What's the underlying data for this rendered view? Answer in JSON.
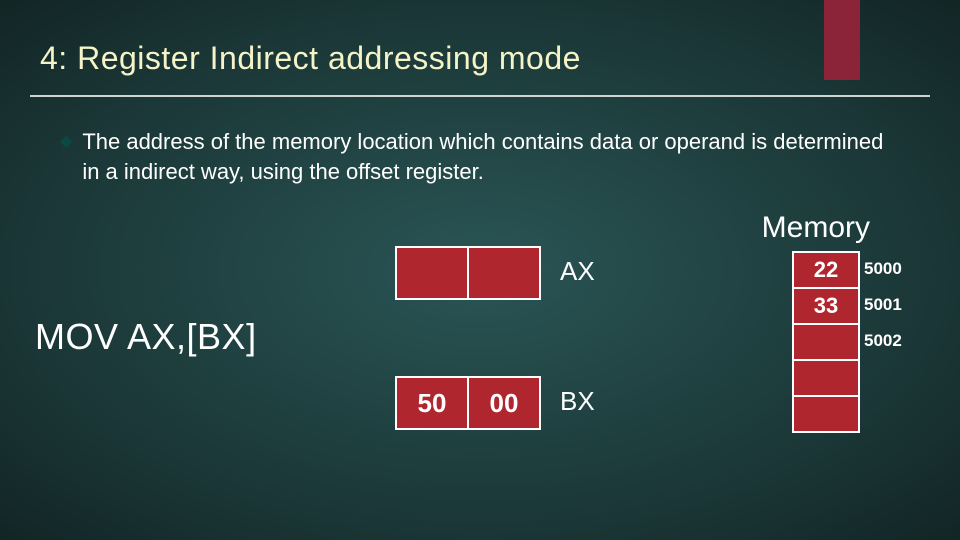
{
  "title": "4: Register Indirect addressing mode",
  "bullet": "The address of the memory location which contains data or operand is determined in a indirect way, using the offset register.",
  "instruction": "MOV AX,[BX]",
  "registers": {
    "ax": {
      "label": "AX",
      "hi": "",
      "lo": ""
    },
    "bx": {
      "label": "BX",
      "hi": "50",
      "lo": "00"
    }
  },
  "memory": {
    "label": "Memory",
    "rows": [
      {
        "value": "22",
        "addr": "5000"
      },
      {
        "value": "33",
        "addr": "5001"
      },
      {
        "value": "",
        "addr": "5002"
      },
      {
        "value": "",
        "addr": ""
      },
      {
        "value": "",
        "addr": ""
      }
    ]
  }
}
